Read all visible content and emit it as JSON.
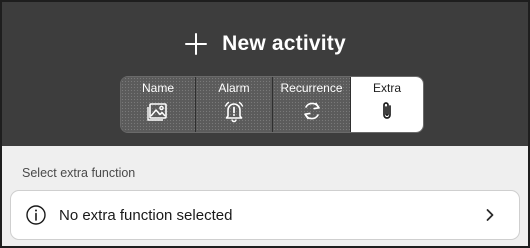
{
  "header": {
    "title": "New activity",
    "title_icon": "plus-icon"
  },
  "tabs": [
    {
      "label": "Name",
      "icon": "image-icon",
      "active": false
    },
    {
      "label": "Alarm",
      "icon": "alarm-bell-icon",
      "active": false
    },
    {
      "label": "Recurrence",
      "icon": "repeat-icon",
      "active": false
    },
    {
      "label": "Extra",
      "icon": "paperclip-icon",
      "active": true
    }
  ],
  "main": {
    "section_label": "Select extra function",
    "selector": {
      "text": "No extra function selected",
      "leading_icon": "info-icon",
      "trailing_icon": "chevron-right-icon"
    }
  },
  "colors": {
    "header_bg": "#3d3d3d",
    "tab_bg": "#5b5b5b",
    "tab_active_bg": "#ffffff",
    "page_bg": "#efefef"
  }
}
